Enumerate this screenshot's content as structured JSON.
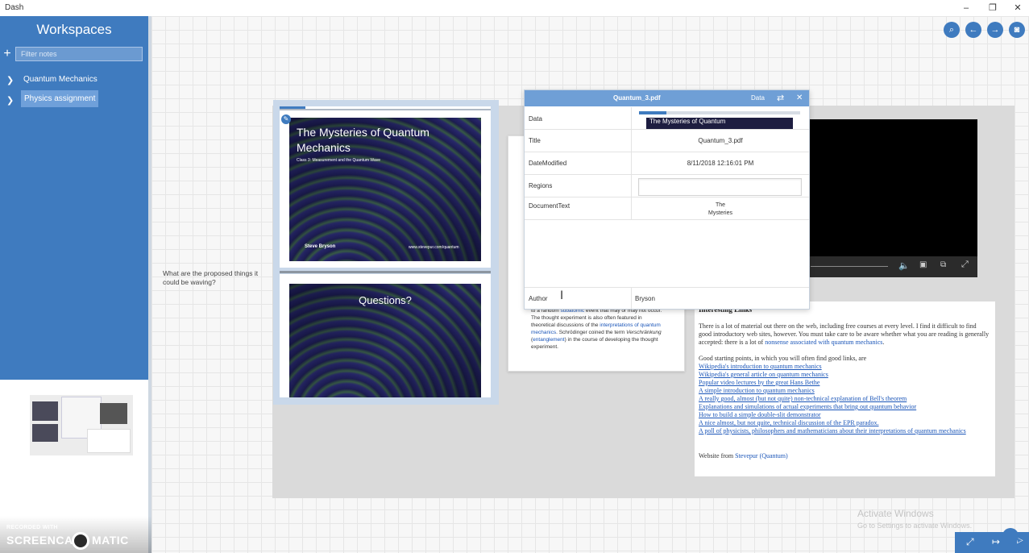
{
  "app": {
    "title": "Dash"
  },
  "window_controls": {
    "minimize": "–",
    "restore": "❐",
    "close": "✕"
  },
  "sidebar": {
    "heading": "Workspaces",
    "add_icon": "+",
    "filter_placeholder": "Filter notes",
    "items": [
      {
        "label": "Quantum Mechanics",
        "selected": false
      },
      {
        "label": "Physics assignment",
        "selected": true
      }
    ]
  },
  "toolbar": {
    "search": "⌕",
    "back": "←",
    "forward": "→",
    "snapshot": "◙"
  },
  "canvas": {
    "note_text": "What are the proposed things it could be waving?",
    "slides": [
      {
        "title": "The Mysteries of Quantum Mechanics",
        "subtitle": "Class 3: Measurement and the Quantum Wave",
        "author": "Steve Bryson",
        "url": "www.stevepur.com/quantum"
      },
      {
        "title": "Questions?"
      }
    ],
    "text_card": {
      "part1": "to a random ",
      "link1": "subatomic",
      "part2": " event that may or may not occur. The thought experiment is also often featured in theoretical discussions of the ",
      "link2": "interpretations of quantum mechanics",
      "part3": ". Schrödinger coined the term ",
      "italic": "Verschränkung",
      "part4": " (",
      "link3": "entanglement",
      "part5": ") in the course of developing the thought experiment."
    },
    "links_doc": {
      "heading": "Interesting Links",
      "intro": "There is a lot of material out there on the web, including free courses at every level. I find it difficult to find good introductory web sites, however. You must take care to be aware whether what you are reading is generally accepted: there is a lot of ",
      "intro_link": "nonsense associated with quantum mechanics",
      "intro_end": ".",
      "starting": "Good starting points, in which you will often find good links, are",
      "links": [
        "Wikipedia's introduction to quantum mechanics",
        "Wikipedia's general article on quantum mechanics",
        "Popular video lectures by the great Hans Bethe",
        "A simple introduction to quantum mechanics",
        "A really good, almost (but not quite) non-technical explanation of Bell's theorem",
        "Explanations and simulations of actual experiments that bring out quantum behavior",
        "How to build a simple double-slit demonstrator",
        "A nice almost, but not quite, technical discussion of the EPR paradox.",
        "A poll of physicists, philosophers and mathematicians about their interpretations of quantum mechanics"
      ],
      "website_prefix": "Website from ",
      "website_link": "Stevepur (Quantum)"
    },
    "video_slide_fragment": "The Mysteries of Quantum"
  },
  "kv_panel": {
    "title": "Quantum_3.pdf",
    "tab": "Data",
    "swap_icon": "⇄",
    "close_icon": "✕",
    "rows": [
      {
        "key": "Data",
        "value": ""
      },
      {
        "key": "Title",
        "value": "Quantum_3.pdf"
      },
      {
        "key": "DateModified",
        "value": "8/11/2018 12:16:01 PM"
      },
      {
        "key": "Regions",
        "value": ""
      },
      {
        "key": "DocumentText",
        "value": "The\nMysteries"
      },
      {
        "key": "Author",
        "value": "Bryson"
      }
    ]
  },
  "watermark": {
    "line1": "Activate Windows",
    "line2": "Go to Settings to activate Windows."
  },
  "recorder": {
    "line1": "RECORDED WITH",
    "line2": "SCREENCAST",
    "line3": "MATIC"
  },
  "colors": {
    "accent": "#3f7bbf",
    "panel_header": "#6f9fd6",
    "link": "#1a55b8"
  }
}
